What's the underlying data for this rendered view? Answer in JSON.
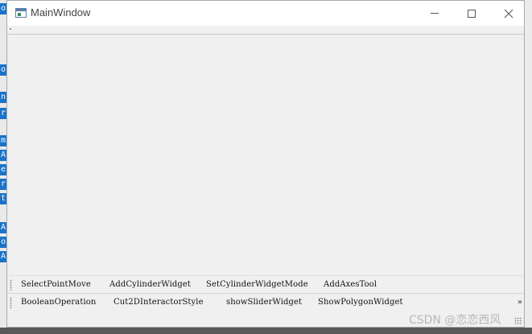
{
  "background_glyphs": [
    "o",
    "n",
    "r",
    "m",
    "A",
    "e",
    "r",
    "t",
    "A",
    "o",
    "A"
  ],
  "window": {
    "title": "MainWindow",
    "controls": {
      "minimize": "minimize",
      "maximize": "maximize",
      "close": "close"
    }
  },
  "toolbar1": {
    "buttons": [
      "SelectPointMove",
      "AddCylinderWidget",
      "SetCylinderWidgetMode",
      "AddAxesTool"
    ]
  },
  "toolbar2": {
    "buttons": [
      "BooleanOperation",
      "Cut2DInteractorStyle",
      "showSliderWidget",
      "ShowPolygonWidget"
    ],
    "extension": "»"
  },
  "watermark": "CSDN @恋恋西风",
  "colors": {
    "window_bg": "#f0f0f0",
    "titlebar_bg": "#ffffff",
    "highlight": "#1b73c8"
  }
}
